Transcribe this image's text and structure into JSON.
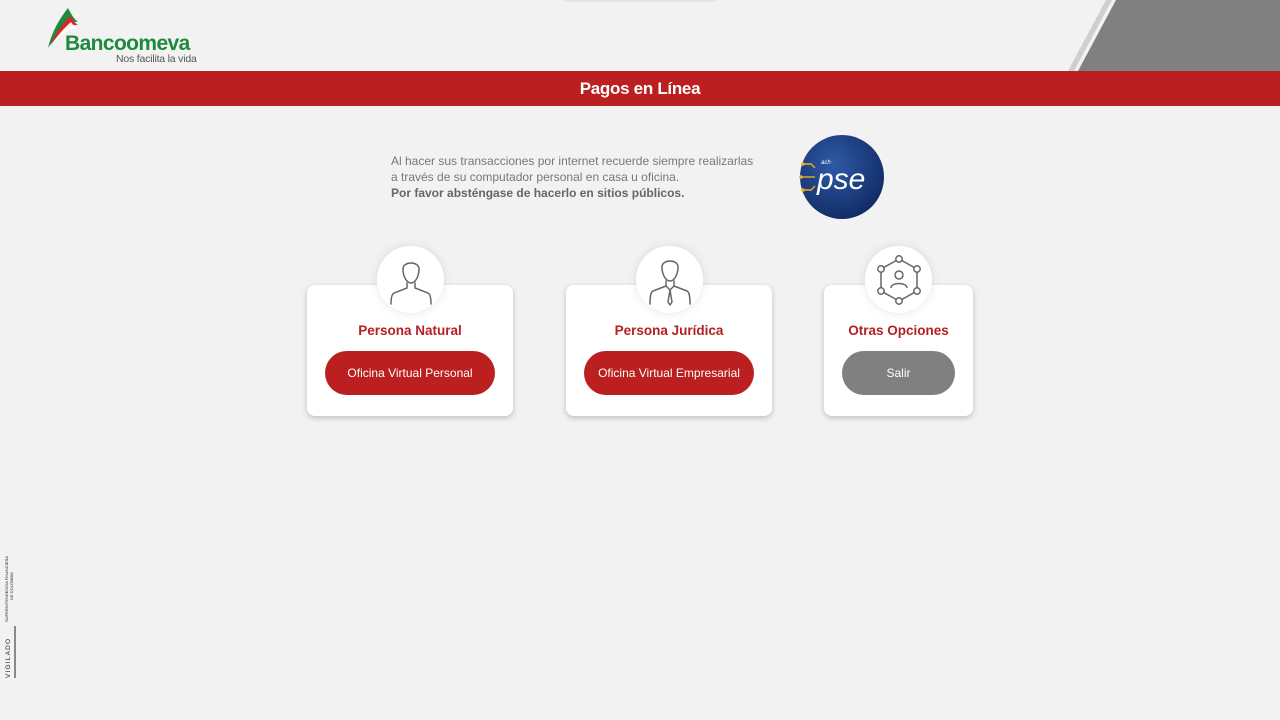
{
  "brand": {
    "name": "Bancoomeva",
    "tagline": "Nos facilita la vida",
    "colors": {
      "green": "#1e8a3e",
      "red": "#bb1f1f",
      "gray": "#808080"
    }
  },
  "page_title": "Pagos en Línea",
  "notice": {
    "line1": "Al hacer sus transacciones por internet recuerde siempre realizarlas",
    "line2": "a través de su computador personal en casa u oficina.",
    "line3": "Por favor absténgase de hacerlo en sitios públicos."
  },
  "pse": {
    "small": "ach",
    "label": "pse"
  },
  "cards": [
    {
      "title": "Persona Natural",
      "button": "Oficina Virtual Personal",
      "icon": "person-icon"
    },
    {
      "title": "Persona Jurídica",
      "button": "Oficina Virtual Empresarial",
      "icon": "businessman-icon"
    },
    {
      "title": "Otras Opciones",
      "button": "Salir",
      "icon": "network-icon"
    }
  ],
  "vigilado": {
    "main": "VIGILADO",
    "line1": "SUPERINTENDENCIA FINANCIERA",
    "line2": "DE COLOMBIA"
  }
}
